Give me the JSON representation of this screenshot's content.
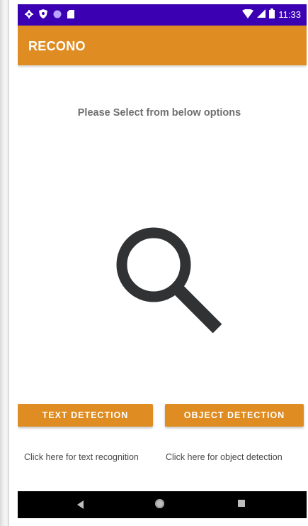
{
  "status_bar": {
    "time": "11:33",
    "left_icons": [
      "settings-icon",
      "shield-icon",
      "circle-dot-icon",
      "sd-card-icon"
    ],
    "right_icons": [
      "wifi-icon",
      "signal-icon",
      "battery-icon"
    ],
    "background_color": "#3a00b2"
  },
  "app_bar": {
    "title": "RECONO",
    "background_color": "#df8c22"
  },
  "main": {
    "prompt": "Please Select from below options",
    "illustration_icon": "search-icon"
  },
  "buttons": {
    "text_detection": "TEXT DETECTION",
    "object_detection": "OBJECT DETECTION",
    "color": "#df8c22"
  },
  "hints": {
    "text_detection": "Click here for text recognition",
    "object_detection": "Click here for object detection"
  },
  "nav_bar": {
    "icons": [
      "back-icon",
      "home-icon",
      "recent-apps-icon"
    ]
  }
}
